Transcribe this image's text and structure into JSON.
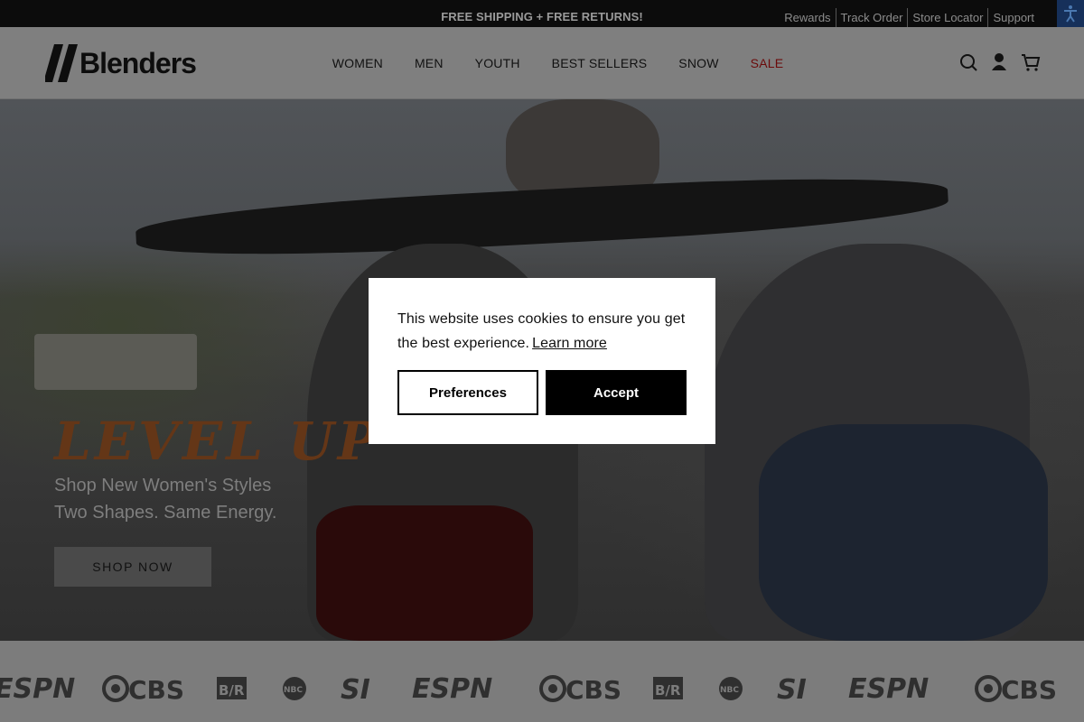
{
  "topbar": {
    "promo": "FREE SHIPPING + FREE RETURNS!",
    "links": [
      "Rewards",
      "Track Order",
      "Store Locator",
      "Support"
    ],
    "accessibility_icon": "accessibility-icon"
  },
  "header": {
    "logo_text": "Blenders",
    "nav": [
      "WOMEN",
      "MEN",
      "YOUTH",
      "BEST SELLERS",
      "SNOW",
      "SALE"
    ],
    "icons": [
      "search-icon",
      "account-icon",
      "cart-icon"
    ]
  },
  "hero": {
    "headline": "LEVEL UP",
    "subline_1": "Shop New Women's Styles",
    "subline_2": "Two Shapes. Same Energy.",
    "cta": "SHOP NOW"
  },
  "press_logos": [
    "ESPN",
    "CBS",
    "B/R",
    "NBC",
    "SI",
    "ESPN",
    "CBS",
    "B/R",
    "NBC",
    "SI",
    "ESPN",
    "CBS"
  ],
  "cookie_modal": {
    "message": "This website uses cookies to ensure you get the best experience.",
    "learn_more": "Learn more",
    "preferences_label": "Preferences",
    "accept_label": "Accept"
  },
  "colors": {
    "accent_sale": "#c8102e",
    "headline_orange": "#c8692a",
    "modal_bg": "#ffffff",
    "button_black": "#000000"
  }
}
